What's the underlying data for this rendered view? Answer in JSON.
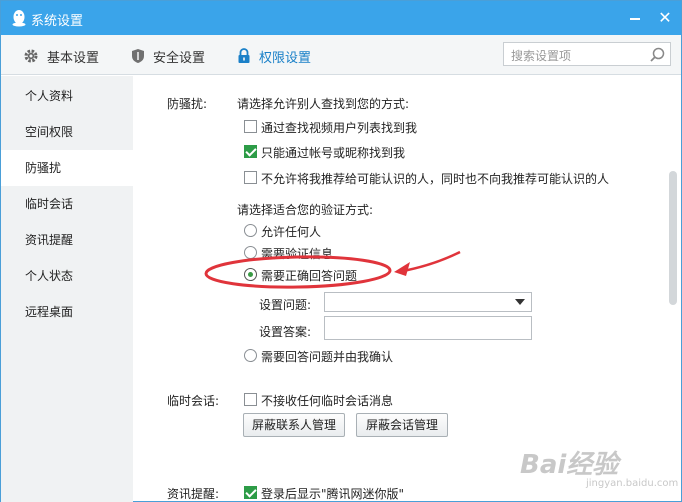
{
  "window": {
    "title": "系统设置",
    "minimize_icon": "minimize-icon",
    "close_label": "✕",
    "accent": "#3aa4ea"
  },
  "tabs": [
    {
      "label": "基本设置",
      "icon": "gear-icon"
    },
    {
      "label": "安全设置",
      "icon": "shield-icon"
    },
    {
      "label": "权限设置",
      "icon": "lock-icon",
      "active": true
    }
  ],
  "search": {
    "placeholder": "搜索设置项",
    "icon": "search-icon"
  },
  "sidebar": {
    "items": [
      {
        "label": "个人资料"
      },
      {
        "label": "空间权限"
      },
      {
        "label": "防骚扰",
        "active": true
      },
      {
        "label": "临时会话"
      },
      {
        "label": "资讯提醒"
      },
      {
        "label": "个人状态"
      },
      {
        "label": "远程桌面"
      }
    ]
  },
  "harassment": {
    "section_label": "防骚扰:",
    "find_prompt": "请选择允许别人查找到您的方式:",
    "find_options": [
      {
        "label": "通过查找视频用户列表找到我",
        "checked": false
      },
      {
        "label": "只能通过帐号或昵称找到我",
        "checked": true
      },
      {
        "label": "不允许将我推荐给可能认识的人，同时也不向我推荐可能认识的人",
        "checked": false
      }
    ],
    "verify_prompt": "请选择适合您的验证方式:",
    "verify_options": [
      {
        "label": "允许任何人",
        "selected": false
      },
      {
        "label": "需要验证信息",
        "selected": false
      },
      {
        "label": "需要正确回答问题",
        "selected": true
      },
      {
        "label": "需要回答问题并由我确认",
        "selected": false
      }
    ],
    "question_label": "设置问题:",
    "question_value": "",
    "answer_label": "设置答案:",
    "answer_value": ""
  },
  "temp_session": {
    "section_label": "临时会话:",
    "option": {
      "label": "不接收任何临时会话消息",
      "checked": false
    },
    "buttons": [
      "屏蔽联系人管理",
      "屏蔽会话管理"
    ]
  },
  "news": {
    "section_label": "资讯提醒:",
    "option": {
      "label": "登录后显示\"腾讯网迷你版\"",
      "checked": true
    }
  },
  "annotation": {
    "color": "#e0343b"
  },
  "watermark": {
    "text": "Bai经验",
    "sub": "jingyan.baidu.com"
  }
}
